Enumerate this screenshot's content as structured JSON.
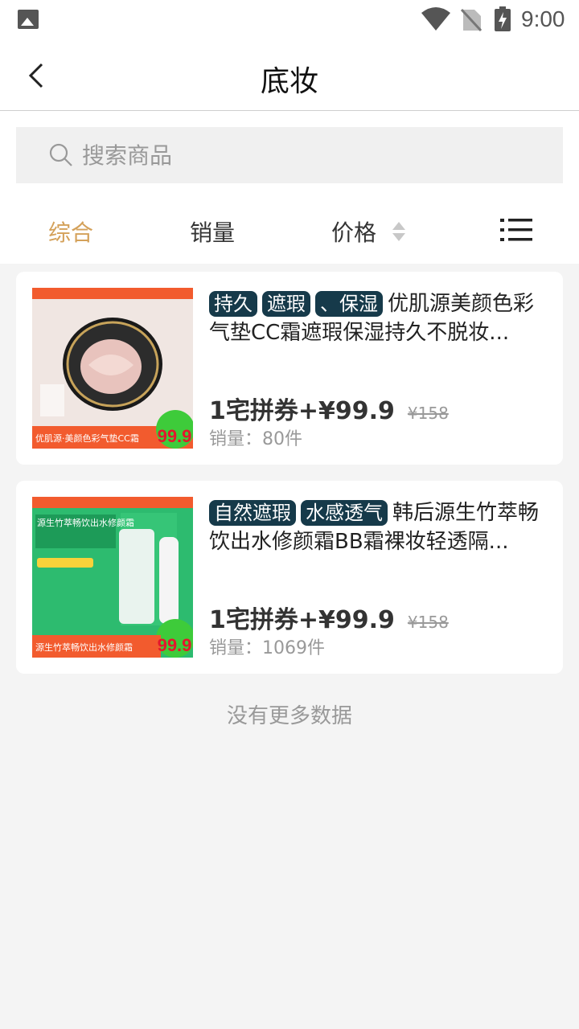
{
  "status_bar": {
    "time": "9:00"
  },
  "header": {
    "title": "底妆"
  },
  "search": {
    "placeholder": "搜索商品"
  },
  "filters": {
    "tabs": [
      "综合",
      "销量",
      "价格"
    ],
    "active_index": 0,
    "active_color": "#d4a15a"
  },
  "products": [
    {
      "tags": [
        "持久",
        "遮瑕",
        "、保湿"
      ],
      "title": "优肌源美颜色彩气垫CC霜遮瑕保湿持久不脱妆...",
      "price": "1宅拼券+¥99.9",
      "old_price": "¥158",
      "sales": "销量：80件",
      "thumb_badge": "99.9",
      "thumb_label": "优肌源·美颜色彩气垫CC霜"
    },
    {
      "tags": [
        "自然遮瑕",
        "水感透气"
      ],
      "title": "韩后源生竹萃畅饮出水修颜霜BB霜裸妆轻透隔...",
      "price": "1宅拼券+¥99.9",
      "old_price": "¥158",
      "sales": "销量：1069件",
      "thumb_badge": "99.9",
      "thumb_label": "源生竹萃畅饮出水修颜霜",
      "thumb_heading": "源生竹萃畅饮出水修颜霜"
    }
  ],
  "footer": {
    "no_more": "没有更多数据"
  },
  "colors": {
    "tag_bg": "#163a4a",
    "accent": "#d4a15a",
    "background": "#f4f4f4"
  }
}
